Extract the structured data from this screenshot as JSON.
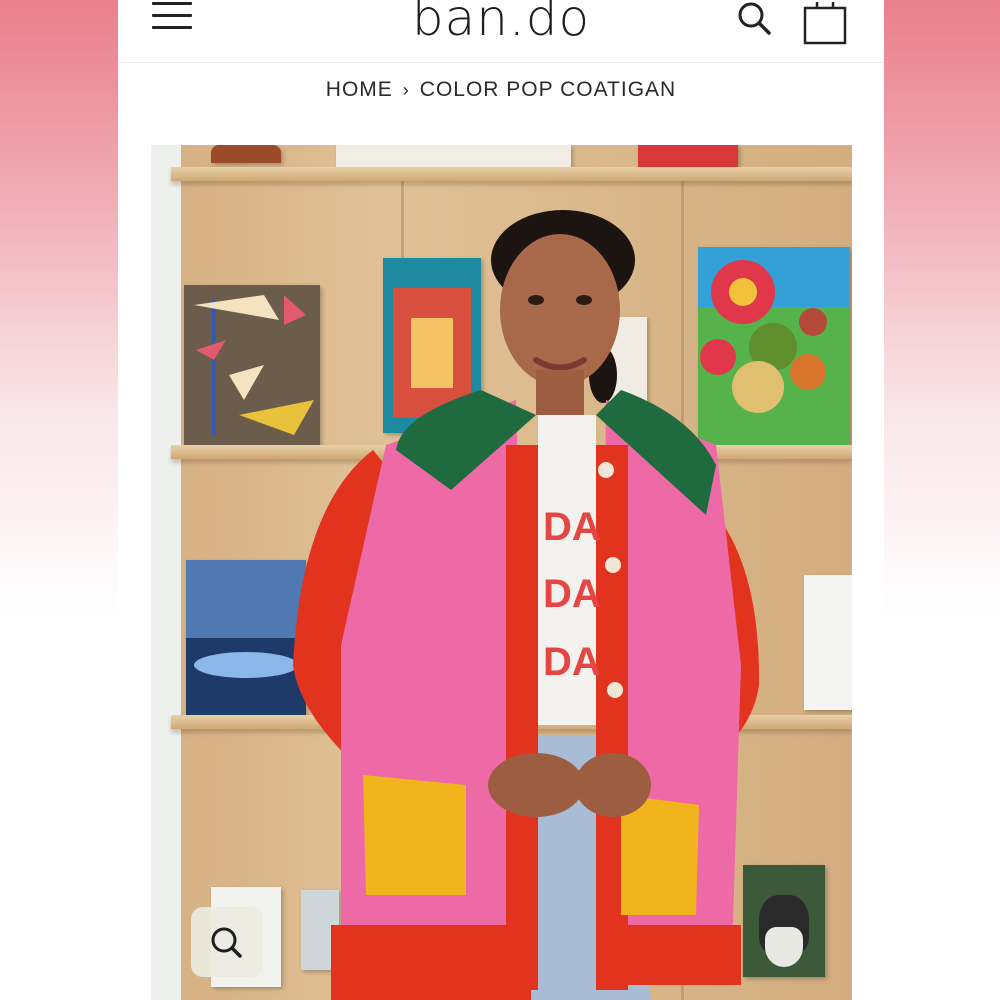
{
  "header": {
    "logo": "ban.do",
    "menu_icon": "hamburger-menu-icon",
    "search_icon": "search-icon",
    "bag_icon": "shopping-bag-icon"
  },
  "breadcrumb": {
    "home": "HOME",
    "separator": "›",
    "current": "COLOR POP COATIGAN"
  },
  "product_image": {
    "zoom_icon": "magnify-icon"
  },
  "colors": {
    "page_gradient_top": "#e97f8c",
    "text": "#2a2a2a",
    "cardigan_pink": "#ee6aa7",
    "cardigan_red": "#e2331f",
    "collar_green": "#1f6a3e",
    "pocket_yellow": "#f2b41c"
  }
}
